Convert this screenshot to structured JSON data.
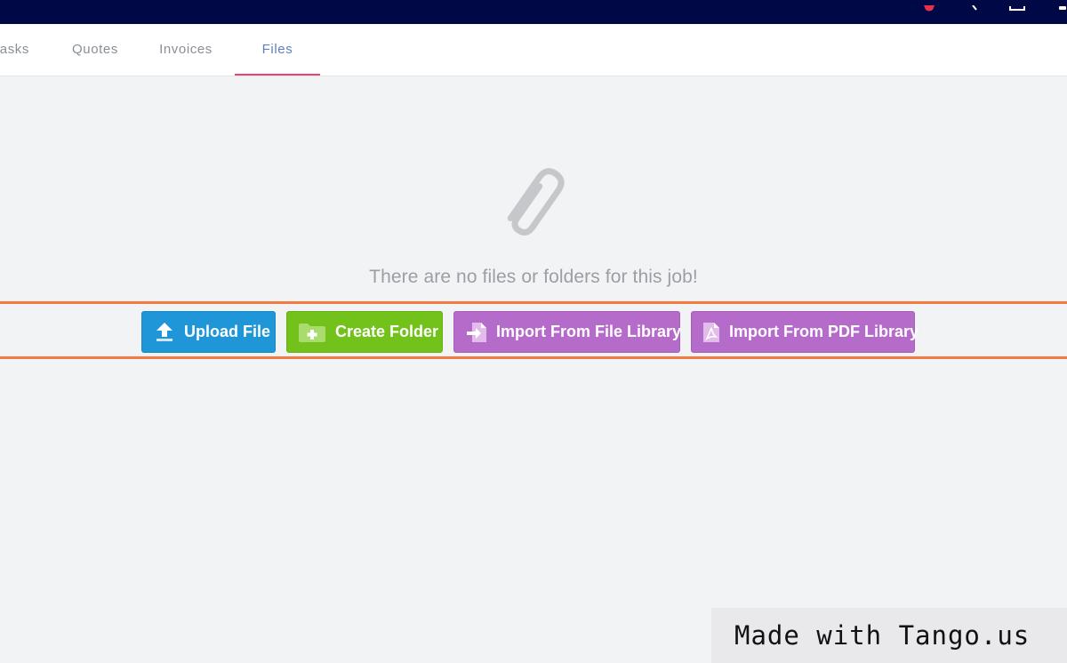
{
  "tabs": [
    {
      "label": "tasks"
    },
    {
      "label": "Quotes"
    },
    {
      "label": "Invoices"
    },
    {
      "label": "Files",
      "active": true
    }
  ],
  "empty_state": {
    "message": "There are no files or folders for this job!",
    "icon": "paperclip-icon"
  },
  "actions": {
    "upload_label": "Upload File",
    "create_folder_label": "Create Folder",
    "import_file_library_label": "Import From File Library",
    "import_pdf_library_label": "Import From PDF Library"
  },
  "watermark": {
    "text": "Made with Tango.us"
  },
  "colors": {
    "topbar": "#010846",
    "active_tab_text": "#5b82bd",
    "active_tab_underline": "#e8476b",
    "upload_button": "#1f96d8",
    "create_folder_button": "#72c21b",
    "import_buttons": "#b56bca",
    "highlight": "#f47a41"
  }
}
